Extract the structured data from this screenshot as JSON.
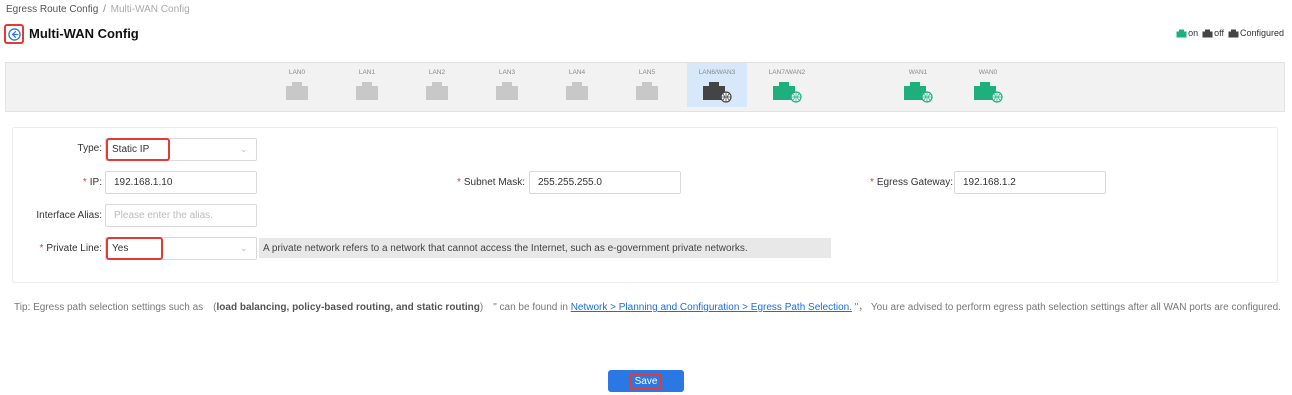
{
  "breadcrumb": {
    "parent": "Egress Route Config",
    "separator": "/",
    "current": "Multi-WAN Config"
  },
  "page_title": "Multi-WAN Config",
  "legend": {
    "on": "on",
    "off": "off",
    "configured": "Configured"
  },
  "colors": {
    "on": "#1db07c",
    "off": "#444444",
    "configured": "#444444",
    "idle": "#c8c8c8",
    "accent": "#2b78e4",
    "highlight": "#e53935"
  },
  "ports": [
    {
      "label": "LAN0",
      "state": "idle"
    },
    {
      "label": "LAN1",
      "state": "idle"
    },
    {
      "label": "LAN2",
      "state": "idle"
    },
    {
      "label": "LAN3",
      "state": "idle"
    },
    {
      "label": "LAN4",
      "state": "idle"
    },
    {
      "label": "LAN5",
      "state": "idle"
    },
    {
      "label": "LAN6/WAN3",
      "state": "configured",
      "selected": true
    },
    {
      "label": "LAN7/WAN2",
      "state": "on"
    },
    {
      "label": "WAN1",
      "state": "on"
    },
    {
      "label": "WAN0",
      "state": "on"
    }
  ],
  "form": {
    "type_label": "Type:",
    "type_value": "Static IP",
    "ip_label": "IP:",
    "ip_value": "192.168.1.10",
    "subnet_label": "Subnet Mask:",
    "subnet_value": "255.255.255.0",
    "gateway_label": "Egress Gateway:",
    "gateway_value": "192.168.1.2",
    "alias_label": "Interface Alias:",
    "alias_placeholder": "Please enter the alias.",
    "private_label": "Private Line:",
    "private_value": "Yes",
    "private_hint": "A private network refers to a network that cannot access the Internet, such as e-government private networks.",
    "required_mark": "*"
  },
  "tip": {
    "prefix": "Tip: Egress path selection settings such as　(",
    "bold": "load balancing, policy-based routing, and static routing",
    "middle": ")　\" can be found in ",
    "link": "Network > Planning and Configuration > Egress Path Selection.",
    "suffix": " \"， You are advised to perform egress path selection settings after all WAN ports are configured."
  },
  "save_label": "Save"
}
